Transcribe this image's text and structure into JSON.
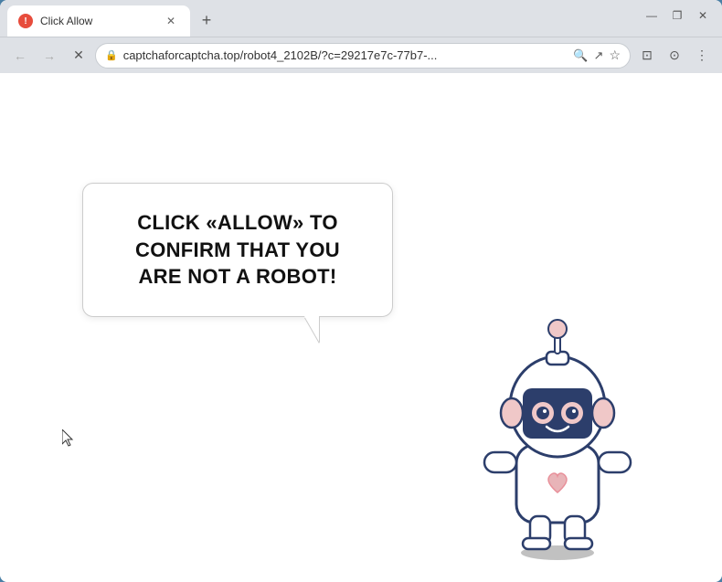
{
  "window": {
    "title": "Click Allow",
    "favicon_label": "!",
    "url": "captchaforcaptcha.top/robot4_2102B/?c=29217e7c-77b7-...",
    "new_tab_symbol": "+",
    "close_symbol": "✕"
  },
  "toolbar": {
    "back_label": "←",
    "forward_label": "→",
    "reload_label": "✕",
    "lock_symbol": "🔒",
    "bookmark_symbol": "☆",
    "extensions_symbol": "⊡",
    "account_symbol": "⊙",
    "menu_symbol": "⋮",
    "share_symbol": "↗",
    "search_symbol": "🔍"
  },
  "window_controls": {
    "minimize": "—",
    "maximize": "❐",
    "close": "✕"
  },
  "page": {
    "bubble_line1": "CLICK «ALLOW» TO CONFIRM THAT YOU",
    "bubble_line2": "ARE NOT A ROBOT!"
  }
}
